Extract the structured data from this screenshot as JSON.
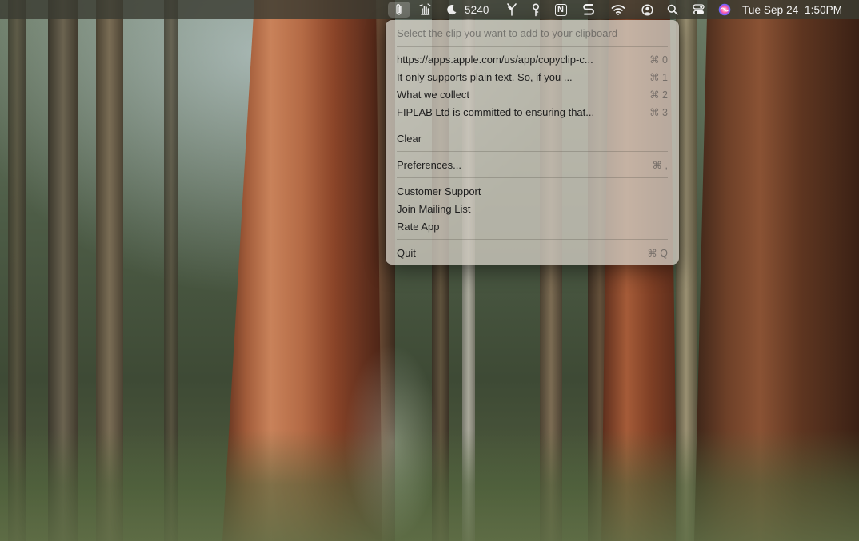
{
  "menubar": {
    "battery_text": "5240",
    "date_time": "Tue Sep 24  1:50PM",
    "icons": [
      "paperclip-icon",
      "gesture-icon",
      "moon-icon",
      "fork-icon",
      "key-icon",
      "notion-icon",
      "s-app-icon",
      "wifi-icon",
      "user-circle-icon",
      "search-icon",
      "control-center-icon",
      "siri-icon"
    ],
    "notion_letter": "N"
  },
  "menu": {
    "header": "Select the clip you want to add to your clipboard",
    "clips": [
      {
        "label": "https://apps.apple.com/us/app/copyclip-c...",
        "shortcut": "⌘ 0"
      },
      {
        "label": "It only supports plain text. So, if you ...",
        "shortcut": "⌘ 1"
      },
      {
        "label": "What we collect",
        "shortcut": "⌘ 2"
      },
      {
        "label": "FIPLAB Ltd is committed to ensuring that...",
        "shortcut": "⌘ 3"
      }
    ],
    "clear_label": "Clear",
    "preferences": {
      "label": "Preferences...",
      "shortcut": "⌘ ,"
    },
    "support_items": [
      {
        "label": "Customer Support"
      },
      {
        "label": "Join Mailing List"
      },
      {
        "label": "Rate App"
      }
    ],
    "quit": {
      "label": "Quit",
      "shortcut": "⌘ Q"
    }
  },
  "colors": {
    "menubar_bg": "#3a3c32",
    "menu_bg": "#cdc8be",
    "menu_text": "#1e1e1e"
  }
}
